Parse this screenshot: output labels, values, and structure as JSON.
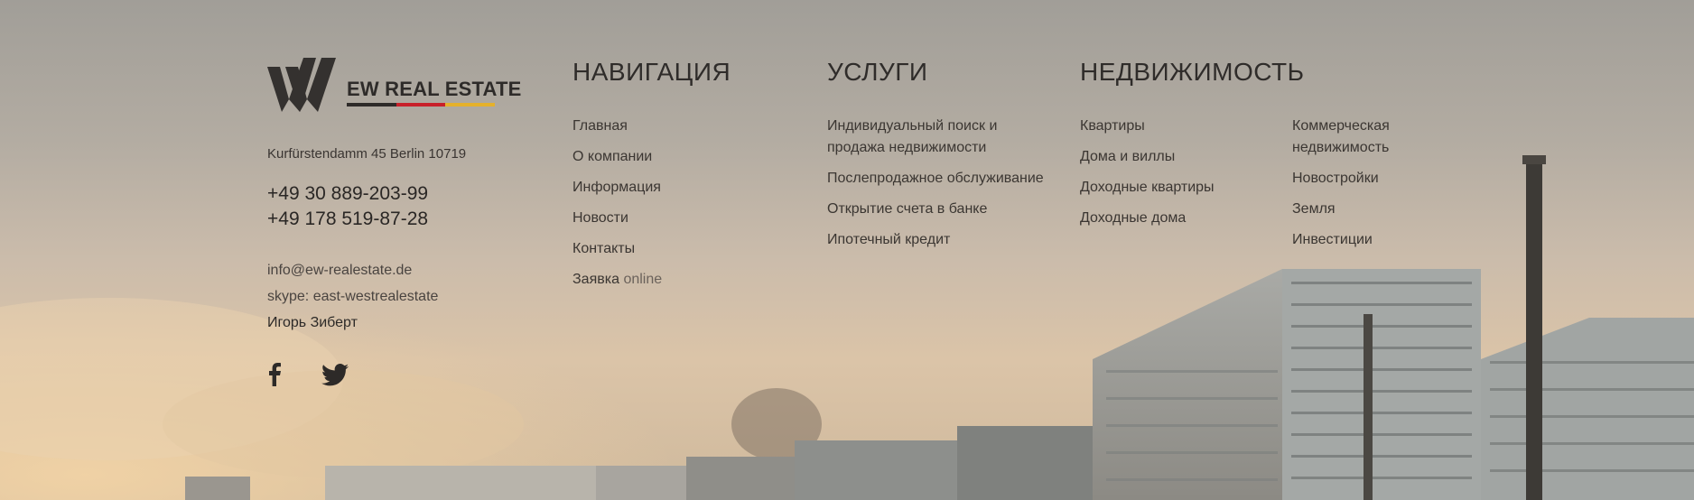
{
  "brand": {
    "name": "EW REAL ESTATE",
    "colors": [
      "#2e2b29",
      "#c8202a",
      "#e5b12c"
    ]
  },
  "contacts": {
    "address": "Kurfürstendamm 45 Berlin 10719",
    "phones": [
      "+49 30 889-203-99",
      "+49 178 519-87-28"
    ],
    "email": "info@ew-realestate.de",
    "skype": "skype: east-westrealestate",
    "person": "Игорь Зиберт"
  },
  "social": {
    "icons": [
      "facebook-icon",
      "twitter-icon"
    ]
  },
  "navigation": {
    "title": "НАВИГАЦИЯ",
    "items": [
      "Главная",
      "О компании",
      "Информация",
      "Новости",
      "Контакты"
    ],
    "last_item": {
      "prefix": "Заявка",
      "suffix": "online"
    }
  },
  "services": {
    "title": "УСЛУГИ",
    "items": [
      "Индивидуальный поиск и продажа недвижимости",
      "Послепродажное обслуживание",
      "Открытие счета в банке",
      "Ипотечный кредит"
    ]
  },
  "realty": {
    "title": "НЕДВИЖИМОСТЬ",
    "col1": [
      "Квартиры",
      "Дома и виллы",
      "Доходные квартиры",
      "Доходные дома"
    ],
    "col2": [
      "Коммерческая недвижимость",
      "Новостройки",
      "Земля",
      "Инвестиции"
    ]
  }
}
